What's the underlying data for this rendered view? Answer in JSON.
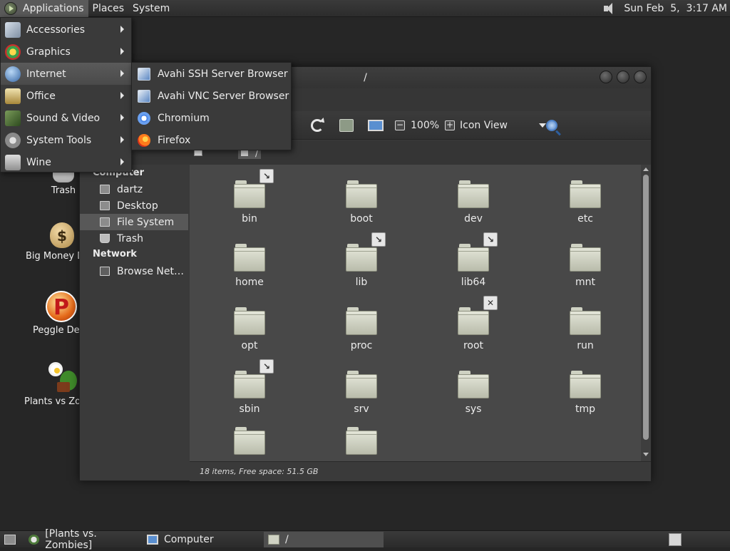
{
  "top_panel": {
    "menus": [
      "Applications",
      "Places",
      "System"
    ],
    "clock": "Sun Feb  5,  3:17 AM"
  },
  "desktop": {
    "icons": [
      "Trash",
      "Big Money D",
      "Peggle Del",
      "Plants vs Zor"
    ]
  },
  "apps_menu": {
    "items": [
      "Accessories",
      "Graphics",
      "Internet",
      "Office",
      "Sound & Video",
      "System Tools",
      "Wine"
    ]
  },
  "internet_submenu": {
    "items": [
      "Avahi SSH Server Browser",
      "Avahi VNC Server Browser",
      "Chromium",
      "Firefox"
    ]
  },
  "window": {
    "title": "/",
    "zoom": "100%",
    "view_mode": "Icon View",
    "location": "/",
    "sidebar": {
      "computer_header": "Computer",
      "network_header": "Network",
      "items": [
        "dartz",
        "Desktop",
        "File System",
        "Trash"
      ],
      "network_items": [
        "Browse Net…"
      ]
    },
    "files": [
      "bin",
      "boot",
      "dev",
      "etc",
      "home",
      "lib",
      "lib64",
      "mnt",
      "opt",
      "proc",
      "root",
      "run",
      "sbin",
      "srv",
      "sys",
      "tmp"
    ],
    "status": "18 items, Free space: 51.5 GB"
  },
  "taskbar": {
    "tasks": [
      "[Plants vs. Zombies]",
      "Computer",
      "/"
    ]
  }
}
